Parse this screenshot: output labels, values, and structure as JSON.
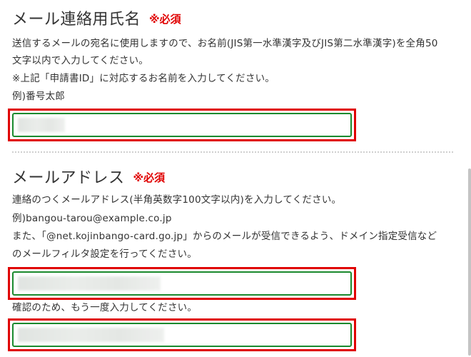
{
  "name_section": {
    "title": "メール連絡用氏名",
    "required": "※必須",
    "desc1": "送信するメールの宛名に使用しますので、お名前(JIS第一水準漢字及びJIS第二水準漢字)を全角50",
    "desc2": "文字以内で入力してください。",
    "note": "※上記「申請書ID」に対応するお名前を入力してください。",
    "example": "例)番号太郎",
    "input_value": ""
  },
  "email_section": {
    "title": "メールアドレス",
    "required": "※必須",
    "desc1": "連絡のつくメールアドレス(半角英数字100文字以内)を入力してください。",
    "example": "例)bangou-tarou@example.co.jp",
    "desc2": "また、「@net.kojinbango-card.go.jp」からのメールが受信できるよう、ドメイン指定受信など",
    "desc3": "のメールフィルタ設定を行ってください。",
    "input_value": "",
    "confirm_label": "確認のため、もう一度入力してください。",
    "confirm_value": ""
  },
  "colors": {
    "required": "#e00000",
    "highlight_border": "#e00000",
    "input_border": "#1a8a2e"
  }
}
